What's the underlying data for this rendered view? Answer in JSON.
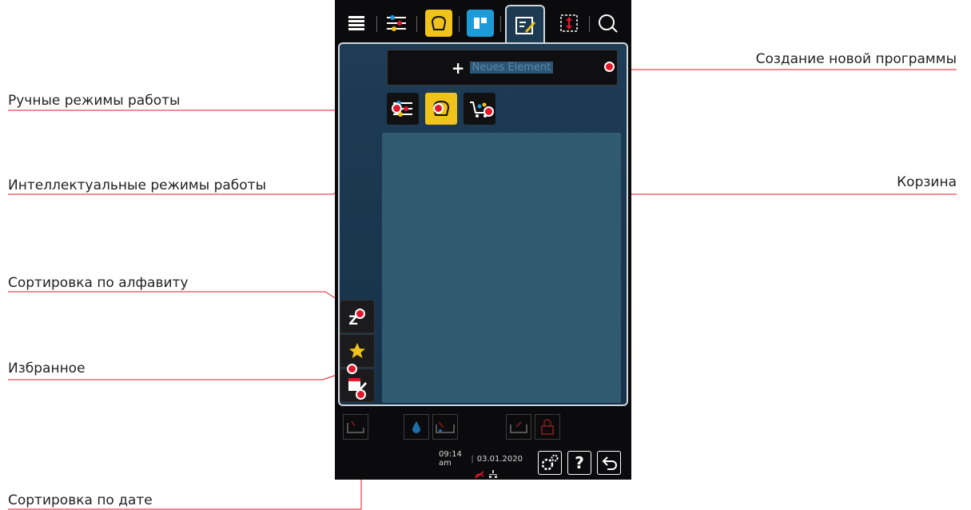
{
  "annotations": {
    "create_program": "Создание новой программы",
    "manual_modes": "Ручные режимы работы",
    "intelligent_modes": "Интеллектуальные режимы работы",
    "basket": "Корзина",
    "sort_alphabet": "Сортировка по алфавиту",
    "favorites": "Избранное",
    "sort_date": "Сортировка по дате"
  },
  "device": {
    "new_element_plus": "+",
    "new_element_label": "Neues Element",
    "sort_alpha_glyph": "Z",
    "status": {
      "time": "09:14 am",
      "date": "03.01.2020"
    },
    "help_button": "?",
    "back_button": "↩"
  },
  "colors": {
    "accent_red": "#e0182a",
    "panel_blue": "#1e3c56",
    "list_blue": "#2f5a70",
    "yellow": "#f0c21a",
    "cyan": "#1c9bd8"
  },
  "icons": {
    "top_tabs": [
      "menu-list-icon",
      "manual-modes-icon",
      "intelligent-modes-icon",
      "ipanel-icon",
      "programming-icon",
      "updown-icon",
      "search-icon"
    ],
    "filters": [
      "manual-modes-icon",
      "intelligent-modes-icon",
      "basket-icon"
    ],
    "bottom": [
      "drain-icon",
      "water-drop-icon",
      "cleaning-tray-icon",
      "arrow-drain-icon",
      "lock-icon"
    ],
    "footer": [
      "settings-gears-icon",
      "help-icon",
      "back-arrow-icon"
    ]
  }
}
